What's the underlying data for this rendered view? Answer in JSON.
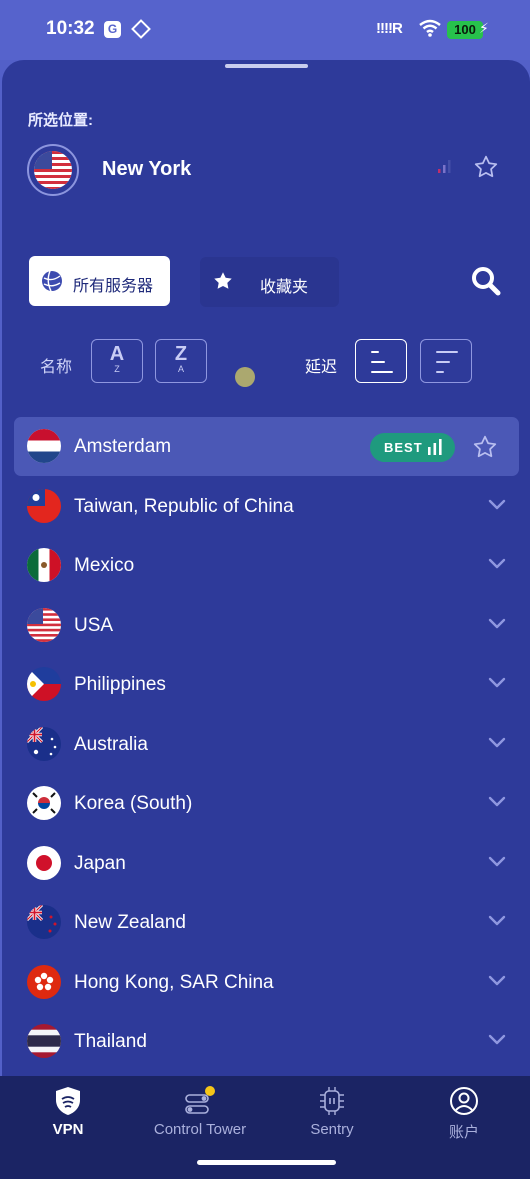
{
  "status_bar": {
    "time": "10:32",
    "g_icon": "G",
    "signal_text": "!!!!R",
    "battery": "100",
    "icons": [
      "g-app-icon",
      "diamond-app-icon",
      "signal-icon",
      "wifi-icon",
      "battery-icon",
      "charging-bolt-icon"
    ]
  },
  "selected": {
    "label": "所选位置:",
    "city": "New York",
    "flag": "usa",
    "icons": [
      "us-flag-icon",
      "signal-bars-icon",
      "star-outline-icon"
    ]
  },
  "tabs": {
    "all_servers": "所有服务器",
    "favorites": "收藏夹"
  },
  "sort": {
    "name_label": "名称",
    "az_big": "A",
    "az_small": "Z",
    "za_big": "Z",
    "za_small": "A",
    "latency_label": "延迟"
  },
  "servers": [
    {
      "name": "Amsterdam",
      "flag": "netherlands",
      "best": true
    },
    {
      "name": "Taiwan, Republic of China",
      "flag": "taiwan"
    },
    {
      "name": "Mexico",
      "flag": "mexico"
    },
    {
      "name": "USA",
      "flag": "usa"
    },
    {
      "name": "Philippines",
      "flag": "philippines"
    },
    {
      "name": "Australia",
      "flag": "australia"
    },
    {
      "name": "Korea (South)",
      "flag": "korea"
    },
    {
      "name": "Japan",
      "flag": "japan"
    },
    {
      "name": "New Zealand",
      "flag": "new-zealand"
    },
    {
      "name": "Hong Kong, SAR China",
      "flag": "hong-kong"
    },
    {
      "name": "Thailand",
      "flag": "thailand"
    }
  ],
  "best_badge": "BEST",
  "nav": {
    "vpn": "VPN",
    "control_tower": "Control Tower",
    "sentry": "Sentry",
    "account": "账户"
  },
  "colors": {
    "sheet": "#2e3a9a",
    "accent_best": "#1f9a7e",
    "nav_bg": "#1b2464",
    "notification_dot": "#f5c518"
  }
}
